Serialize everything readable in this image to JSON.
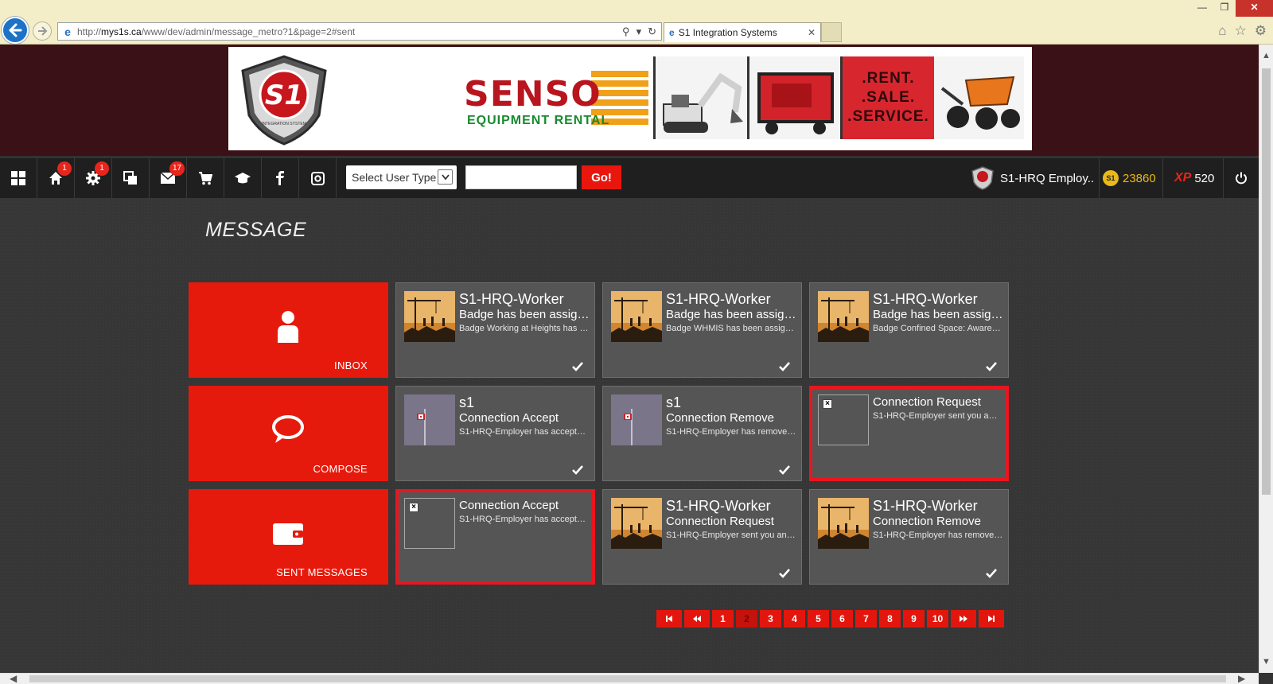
{
  "browser": {
    "url_prefix": "http://",
    "url_host": "mys1s.ca",
    "url_path": "/www/dev/admin/message_metro?1&page=2#sent",
    "tab_title": "S1 Integration Systems"
  },
  "banner": {
    "logo_text": "S1",
    "logo_sub": "INTEGRATION SYSTEM",
    "ad_brand": "SENSO",
    "ad_sub": "EQUIPMENT RENTAL",
    "ad_rent_lines": [
      ".RENT.",
      ".SALE.",
      ".SERVICE."
    ]
  },
  "topbar": {
    "badges": {
      "home": "1",
      "settings": "1",
      "mail": "17"
    },
    "user_type_select": "Select User Type",
    "search_value": "",
    "go_label": "Go!",
    "user_name": "S1-HRQ Employ..",
    "coins": "23860",
    "coin_symbol": "S1",
    "xp_symbol": "XP",
    "xp_points": "520"
  },
  "page": {
    "title": "MESSAGE"
  },
  "tiles": [
    {
      "label": "INBOX",
      "icon": "person-icon"
    },
    {
      "label": "COMPOSE",
      "icon": "speech-bubble-icon"
    },
    {
      "label": "SENT MESSAGES",
      "icon": "wallet-icon"
    }
  ],
  "messages": [
    {
      "from": "S1-HRQ-Worker",
      "subject": "Badge has been assign...",
      "body": "Badge Working at Heights has b...",
      "thumb": "construction",
      "read": true,
      "selected": false
    },
    {
      "from": "S1-HRQ-Worker",
      "subject": "Badge has been assign...",
      "body": "Badge WHMIS has been assigne...",
      "thumb": "construction",
      "read": true,
      "selected": false
    },
    {
      "from": "S1-HRQ-Worker",
      "subject": "Badge has been assign...",
      "body": "Badge Confined Space: Awarene...",
      "thumb": "construction",
      "read": true,
      "selected": false
    },
    {
      "from": "s1",
      "subject": "Connection Accept",
      "body": "S1-HRQ-Employer has accepted...",
      "thumb": "flag",
      "read": true,
      "selected": false
    },
    {
      "from": "s1",
      "subject": "Connection Remove",
      "body": "S1-HRQ-Employer has removed...",
      "thumb": "flag",
      "read": true,
      "selected": false
    },
    {
      "from": "",
      "subject": "Connection Request",
      "body": "S1-HRQ-Employer sent you an i...",
      "thumb": "broken",
      "read": false,
      "selected": true
    },
    {
      "from": "",
      "subject": "Connection Accept",
      "body": "S1-HRQ-Employer has accepted...",
      "thumb": "broken",
      "read": false,
      "selected": true
    },
    {
      "from": "S1-HRQ-Worker",
      "subject": "Connection Request",
      "body": "S1-HRQ-Employer sent you an i...",
      "thumb": "construction",
      "read": true,
      "selected": false
    },
    {
      "from": "S1-HRQ-Worker",
      "subject": "Connection Remove",
      "body": "S1-HRQ-Employer has removed...",
      "thumb": "construction",
      "read": true,
      "selected": false
    }
  ],
  "pagination": {
    "first": "⏮",
    "prev": "⏪",
    "next": "⏩",
    "last": "⏭",
    "pages": [
      "1",
      "2",
      "3",
      "4",
      "5",
      "6",
      "7",
      "8",
      "9",
      "10"
    ],
    "current": "2"
  },
  "colors": {
    "accent": "#e61a0c",
    "banner_bg": "#3a1116",
    "topbar_bg": "#1f1f1f",
    "content_bg": "#363636",
    "coin": "#e9b91a"
  }
}
